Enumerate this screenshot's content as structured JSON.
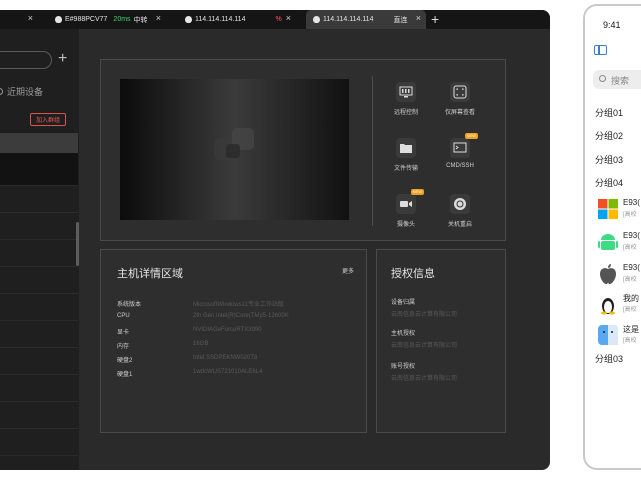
{
  "tabs": [
    {
      "device": "E#988PCV77",
      "latency": "20ms",
      "route": "中转"
    },
    {
      "device": "114.114.114.114",
      "status": "%"
    },
    {
      "device": "114.114.114.114",
      "mode": "直连"
    }
  ],
  "sidebar": {
    "recent_label": "近期设备",
    "join_button": "加入群组"
  },
  "functions": [
    {
      "label": "远程控制",
      "icon": "remote-control-icon"
    },
    {
      "label": "仅屏幕查看",
      "icon": "screen-view-icon"
    },
    {
      "label": "文件传输",
      "icon": "folder-icon"
    },
    {
      "label": "CMD/SSH",
      "icon": "terminal-icon",
      "badge": "NEW"
    },
    {
      "label": "摄像头",
      "icon": "camera-icon",
      "badge": "NEW"
    },
    {
      "label": "关机重启",
      "icon": "power-icon"
    }
  ],
  "host": {
    "title": "主机详情区域",
    "more": "更多",
    "rows": [
      {
        "key": "系统版本",
        "value": "MicrosoftWindows11专业工作站版"
      },
      {
        "key": "CPU",
        "value": "2th Gen Intel(R)Core(TM)i5-12600K"
      },
      {
        "key": "显卡",
        "value": "NVIDIAGeForceRTX3090"
      },
      {
        "key": "内存",
        "value": "16GB"
      },
      {
        "key": "硬盘2",
        "value": "Intel SSDPEKNW020T8"
      },
      {
        "key": "硬盘1",
        "value": "1wdcWUS721010ALE6L4"
      }
    ]
  },
  "auth": {
    "title": "授权信息",
    "rows": [
      {
        "key": "设备归属",
        "value": "云南信息云计算有限公司"
      },
      {
        "key": "主机授权",
        "value": "云南信息云计算有限公司"
      },
      {
        "key": "账号授权",
        "value": "云南信息云计算有限公司"
      }
    ]
  },
  "phone": {
    "time": "9:41",
    "search_placeholder": "搜索",
    "groups": [
      "分组01",
      "分组02",
      "分组03",
      "分组04"
    ],
    "devices": [
      {
        "name": "E93(",
        "sub": "[高校",
        "os": "windows-icon"
      },
      {
        "name": "E93(",
        "sub": "[高校",
        "os": "android-icon"
      },
      {
        "name": "E93(",
        "sub": "[高校",
        "os": "apple-icon"
      },
      {
        "name": "我的",
        "sub": "[高校",
        "os": "linux-icon"
      },
      {
        "name": "这是",
        "sub": "[高校",
        "os": "finder-icon"
      }
    ],
    "last_group": "分组03"
  }
}
